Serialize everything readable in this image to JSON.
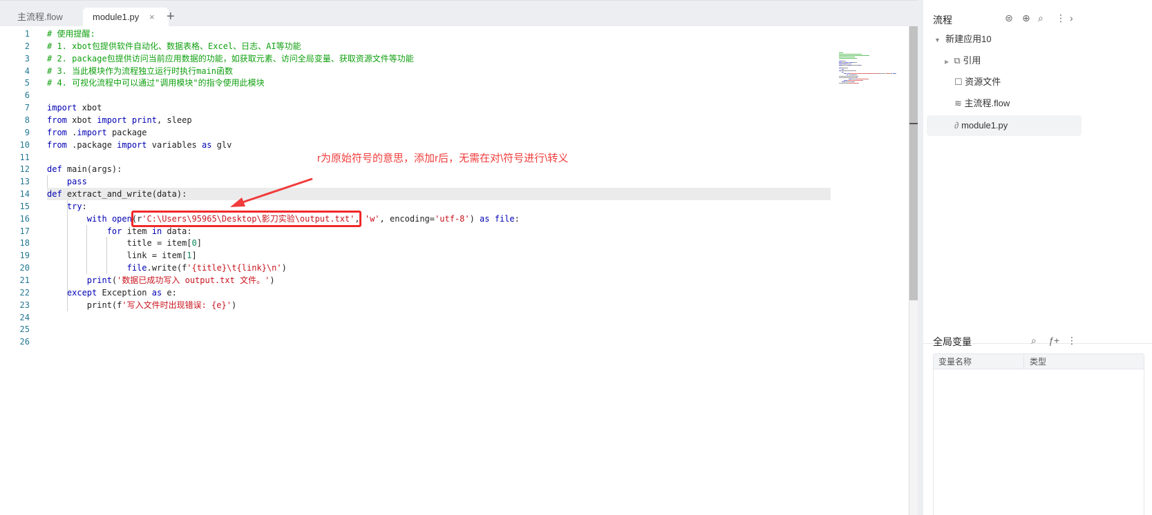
{
  "tabs": [
    {
      "label": "主流程.flow"
    },
    {
      "label": "module1.py",
      "close": "×"
    }
  ],
  "add_tab": "+",
  "code_lines": [
    [
      [
        "# 使用提醒:",
        "cm"
      ]
    ],
    [
      [
        "# 1. xbot包提供软件自动化、数据表格、Excel、日志、AI等功能",
        "cm"
      ]
    ],
    [
      [
        "# 2. package包提供访问当前应用数据的功能，如获取元素、访问全局变量、获取资源文件等功能",
        "cm"
      ]
    ],
    [
      [
        "# 3. 当此模块作为流程独立运行时执行main函数",
        "cm"
      ]
    ],
    [
      [
        "# 4. 可视化流程中可以通过\"调用模块\"的指令使用此模块",
        "cm"
      ]
    ],
    [],
    [
      [
        "import",
        "kw"
      ],
      [
        " xbot",
        "pl"
      ]
    ],
    [
      [
        "from",
        "kw"
      ],
      [
        " xbot ",
        "pl"
      ],
      [
        "import",
        "kw"
      ],
      [
        " ",
        "pl"
      ],
      [
        "print",
        "kw"
      ],
      [
        ", sleep",
        "pl"
      ]
    ],
    [
      [
        "from",
        "kw"
      ],
      [
        " .",
        "pl"
      ],
      [
        "import",
        "kw"
      ],
      [
        " package",
        "pl"
      ]
    ],
    [
      [
        "from",
        "kw"
      ],
      [
        " .package ",
        "pl"
      ],
      [
        "import",
        "kw"
      ],
      [
        " variables ",
        "pl"
      ],
      [
        "as",
        "kw"
      ],
      [
        " glv",
        "pl"
      ]
    ],
    [],
    [
      [
        "def",
        "kw"
      ],
      [
        " main(args):",
        "pl"
      ]
    ],
    [
      [
        "    ",
        "pl"
      ],
      [
        "pass",
        "kw"
      ]
    ],
    [
      [
        "def",
        "kw"
      ],
      [
        " extract_and_write(data):",
        "pl"
      ]
    ],
    [
      [
        "    ",
        "pl"
      ],
      [
        "try",
        "kw"
      ],
      [
        ":",
        "pl"
      ]
    ],
    [
      [
        "        ",
        "pl"
      ],
      [
        "with",
        "kw"
      ],
      [
        " ",
        "pl"
      ],
      [
        "open",
        "kw"
      ],
      [
        "(r",
        "pl"
      ],
      [
        "'C:\\Users\\95965\\Desktop\\影刀实验\\output.txt'",
        "str"
      ],
      [
        ", ",
        "pl"
      ],
      [
        "'w'",
        "str"
      ],
      [
        ", encoding=",
        "pl"
      ],
      [
        "'utf-8'",
        "str"
      ],
      [
        ") ",
        "pl"
      ],
      [
        "as",
        "kw"
      ],
      [
        " ",
        "pl"
      ],
      [
        "file",
        "kw"
      ],
      [
        ":",
        "pl"
      ]
    ],
    [
      [
        "            ",
        "pl"
      ],
      [
        "for",
        "kw"
      ],
      [
        " item ",
        "pl"
      ],
      [
        "in",
        "kw"
      ],
      [
        " data:",
        "pl"
      ]
    ],
    [
      [
        "                title = item[",
        "pl"
      ],
      [
        "0",
        "num"
      ],
      [
        "]",
        "pl"
      ]
    ],
    [
      [
        "                link = item[",
        "pl"
      ],
      [
        "1",
        "num"
      ],
      [
        "]",
        "pl"
      ]
    ],
    [
      [
        "                ",
        "pl"
      ],
      [
        "file",
        "kw"
      ],
      [
        ".write(f",
        "pl"
      ],
      [
        "'{title}\\t{link}\\n'",
        "str"
      ],
      [
        ")",
        "pl"
      ]
    ],
    [
      [
        "        ",
        "pl"
      ],
      [
        "print",
        "kw"
      ],
      [
        "(",
        "pl"
      ],
      [
        "'数据已成功写入 output.txt 文件。'",
        "str"
      ],
      [
        ")",
        "pl"
      ]
    ],
    [
      [
        "    ",
        "pl"
      ],
      [
        "except",
        "kw"
      ],
      [
        " Exception ",
        "pl"
      ],
      [
        "as",
        "kw"
      ],
      [
        " e:",
        "pl"
      ]
    ],
    [
      [
        "        print(f",
        "pl"
      ],
      [
        "'写入文件时出现错误: {e}'",
        "str"
      ],
      [
        ")",
        "pl"
      ]
    ],
    [],
    [],
    []
  ],
  "annotation": "r为原始符号的意思，添加r后，无需在对\\符号进行\\转义",
  "panel": {
    "title": "流程",
    "tree": [
      {
        "label": "新建应用10",
        "icon": "caret-down-icon"
      },
      {
        "label": "引用",
        "icon": "reference-icon"
      },
      {
        "label": "资源文件",
        "icon": "resource-icon"
      },
      {
        "label": "主流程.flow",
        "icon": "layers-icon"
      },
      {
        "label": "module1.py",
        "icon": "python-icon"
      }
    ],
    "globals_title": "全局变量",
    "columns": [
      "变量名称",
      "类型"
    ]
  },
  "colors": {
    "accent": "#f02828",
    "comment": "#10a010",
    "keyword": "#0000b4",
    "string": "#c8141e"
  }
}
